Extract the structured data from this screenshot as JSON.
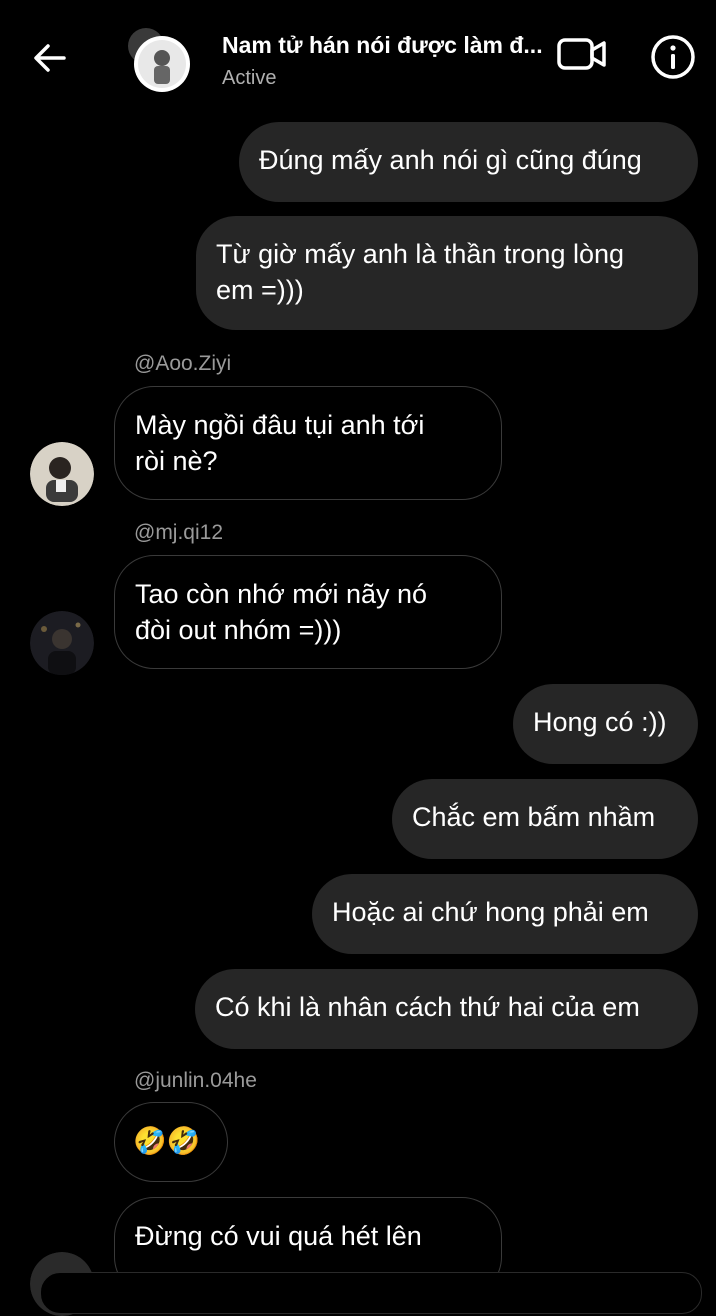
{
  "header": {
    "title": "Nam tử hán nói được làm đ...",
    "status": "Active",
    "icons": {
      "back": "arrow-left-icon",
      "video": "video-call-icon",
      "info": "info-icon"
    }
  },
  "messages": [
    {
      "direction": "outgoing",
      "text": "Đúng mấy anh nói gì cũng đúng"
    },
    {
      "direction": "outgoing",
      "text_lines": [
        "Từ giờ mấy anh là thần trong lòng",
        "em =)))"
      ]
    },
    {
      "direction": "incoming",
      "sender": "@Aoo.Ziyi",
      "text_lines": [
        "Mày ngồi đâu tụi anh tới",
        "ròi nè?"
      ]
    },
    {
      "direction": "incoming",
      "sender": "@mj.qi12",
      "text_lines": [
        "Tao còn nhớ mới nãy nó",
        "đòi out nhóm =)))"
      ]
    },
    {
      "direction": "outgoing",
      "text": "Hong có :))"
    },
    {
      "direction": "outgoing",
      "text": "Chắc em bấm nhầm"
    },
    {
      "direction": "outgoing",
      "text": "Hoặc ai chứ hong phải em"
    },
    {
      "direction": "outgoing",
      "text": "Có khi là nhân cách thứ hai của em"
    },
    {
      "direction": "incoming",
      "sender": "@junlin.04he",
      "emoji": "🤣🤣"
    },
    {
      "direction": "incoming",
      "text": "Đừng có vui quá hét lên"
    }
  ],
  "colors": {
    "background": "#000000",
    "outgoing_bubble": "#262626",
    "incoming_border": "#3a3a3a",
    "sender_text": "#9a9a9a"
  }
}
